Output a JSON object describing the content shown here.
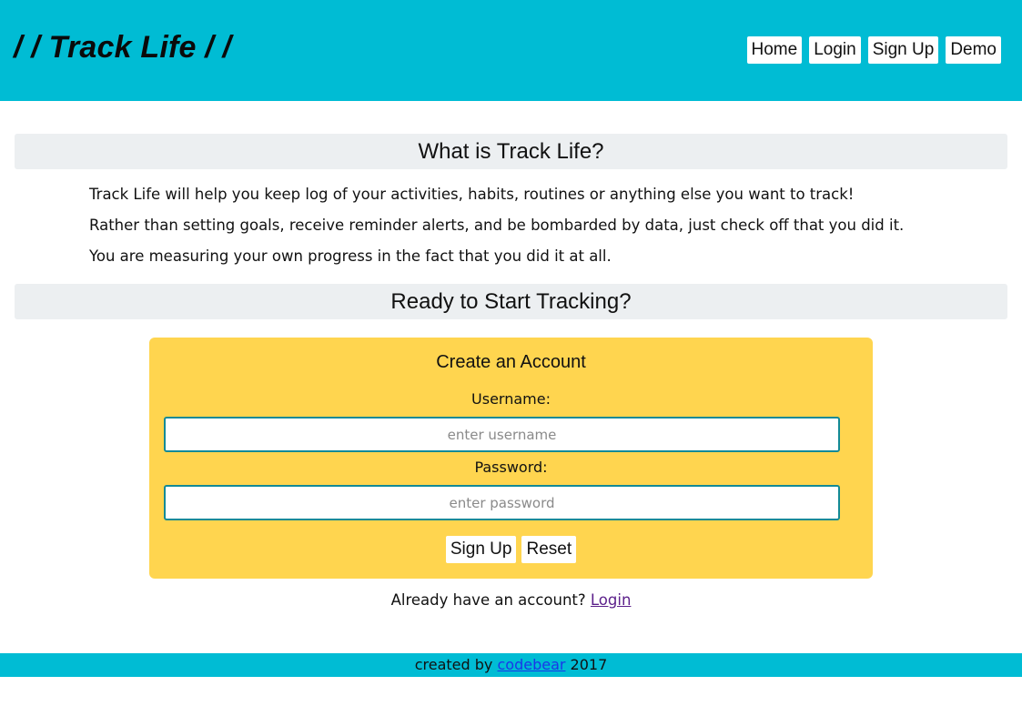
{
  "header": {
    "brand": "/ / Track Life / /",
    "nav": [
      "Home",
      "Login",
      "Sign Up",
      "Demo"
    ]
  },
  "about": {
    "title": "What is Track Life?",
    "lines": [
      "Track Life will help you keep log of your activities, habits, routines or anything else you want to track!",
      "Rather than setting goals, receive reminder alerts, and be bombarded by data, just check off that you did it.",
      "You are measuring your own progress in the fact that you did it at all."
    ]
  },
  "start": {
    "title": "Ready to Start Tracking?"
  },
  "signup_form": {
    "title": "Create an Account",
    "username_label": "Username:",
    "username_placeholder": "enter username",
    "username_value": "",
    "password_label": "Password:",
    "password_placeholder": "enter password",
    "password_value": "",
    "submit_label": "Sign Up",
    "reset_label": "Reset"
  },
  "login_prompt": {
    "text": "Already have an account?",
    "link": "Login"
  },
  "footer": {
    "prefix": "created by",
    "author": "codebear",
    "year": "2017"
  },
  "colors": {
    "header_bg": "#00bcd4",
    "section_bg": "#eceff1",
    "card_bg": "#ffd54f",
    "input_border": "#138a96",
    "visited_link": "#5b1f8a",
    "link": "#1a37e8"
  }
}
